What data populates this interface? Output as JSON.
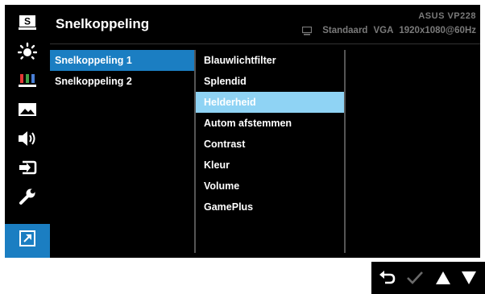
{
  "header": {
    "title": "Snelkoppeling",
    "model": "ASUS  VP228",
    "mode": "Standaard",
    "input": "VGA",
    "resolution": "1920x1080@60Hz"
  },
  "sidebar": {
    "items": [
      {
        "icon": "splendid-s-icon"
      },
      {
        "icon": "brightness-icon"
      },
      {
        "icon": "color-bars-icon"
      },
      {
        "icon": "image-icon"
      },
      {
        "icon": "sound-icon"
      },
      {
        "icon": "input-select-icon"
      },
      {
        "icon": "wrench-icon"
      },
      {
        "icon": "shortcut-arrow-icon",
        "active": true
      }
    ]
  },
  "menu1": {
    "items": [
      {
        "label": "Snelkoppeling 1",
        "active": true
      },
      {
        "label": "Snelkoppeling 2"
      }
    ]
  },
  "menu2": {
    "items": [
      {
        "label": "Blauwlichtfilter"
      },
      {
        "label": "Splendid"
      },
      {
        "label": "Helderheid",
        "highlighted": true
      },
      {
        "label": "Autom afstemmen"
      },
      {
        "label": "Contrast"
      },
      {
        "label": "Kleur"
      },
      {
        "label": "Volume"
      },
      {
        "label": "GamePlus"
      }
    ]
  },
  "nav_keys": [
    "back-icon",
    "check-icon",
    "up-arrow-icon",
    "down-arrow-icon"
  ],
  "colors": {
    "accent": "#1b7ec2",
    "highlight": "#8fd3f4",
    "background": "#000000",
    "dim_text": "#7a7a7a"
  }
}
